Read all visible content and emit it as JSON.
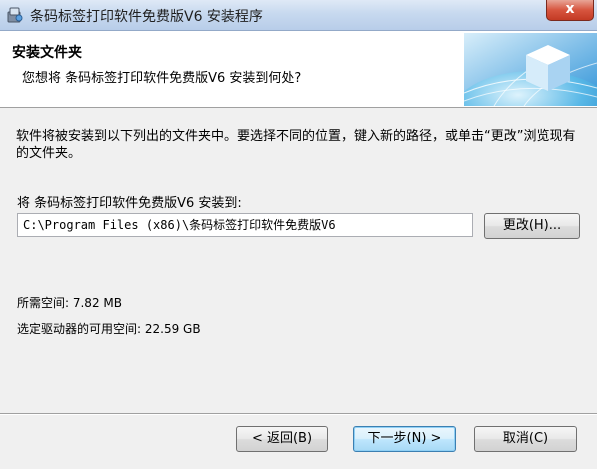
{
  "window": {
    "title": "条码标签打印软件免费版V6 安装程序",
    "close_glyph": "x"
  },
  "header": {
    "title": "安装文件夹",
    "subtitle": "您想将 条码标签打印软件免费版V6 安装到何处?"
  },
  "content": {
    "description": "软件将被安装到以下列出的文件夹中。要选择不同的位置，键入新的路径，或单击“更改”浏览现有的文件夹。",
    "install_to_label": "将 条码标签打印软件免费版V6 安装到:",
    "install_path": "C:\\Program Files (x86)\\条码标签打印软件免费版V6",
    "change_button": "更改(H)...",
    "space_required": "所需空间: 7.82 MB",
    "space_available": "选定驱动器的可用空间: 22.59 GB"
  },
  "footer": {
    "back_button": "< 返回(B)",
    "next_button": "下一步(N) >",
    "cancel_button": "取消(C)"
  },
  "icons": {
    "app": "installer-app-icon",
    "banner": "cube-globe-banner",
    "close": "close-icon"
  },
  "colors": {
    "titlebar": "#c7d9ef",
    "close_button": "#d7553f",
    "default_button_border": "#3c7fb1"
  }
}
